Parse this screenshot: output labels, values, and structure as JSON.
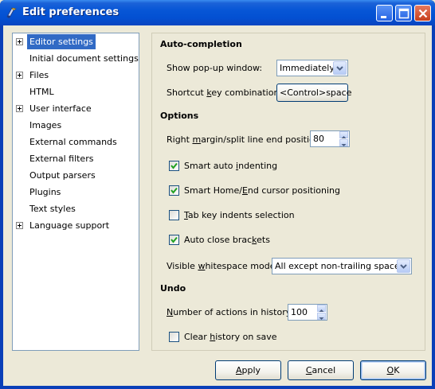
{
  "window": {
    "title": "Edit preferences",
    "icon": "gear-app-icon"
  },
  "tree": {
    "items": [
      {
        "label": "Editor settings",
        "expandable": true,
        "selected": true
      },
      {
        "label": "Initial document settings",
        "expandable": false
      },
      {
        "label": "Files",
        "expandable": true
      },
      {
        "label": "HTML",
        "expandable": false
      },
      {
        "label": "User interface",
        "expandable": true
      },
      {
        "label": "Images",
        "expandable": false
      },
      {
        "label": "External commands",
        "expandable": false
      },
      {
        "label": "External filters",
        "expandable": false
      },
      {
        "label": "Output parsers",
        "expandable": false
      },
      {
        "label": "Plugins",
        "expandable": false
      },
      {
        "label": "Text styles",
        "expandable": false
      },
      {
        "label": "Language support",
        "expandable": true
      }
    ]
  },
  "autocompletion": {
    "title": "Auto-completion",
    "popup_label": "Show pop-up window:",
    "popup_value": "Immediately",
    "shortcut_label_pre": "Shortcut ",
    "shortcut_label_key": "k",
    "shortcut_label_post": "ey combination:",
    "shortcut_value": "<Control>space"
  },
  "options": {
    "title": "Options",
    "right_margin_label_pre": "Right ",
    "right_margin_label_key": "m",
    "right_margin_label_post": "argin/split line end position:",
    "right_margin_value": "80",
    "smart_indent": {
      "pre": "Smart auto ",
      "key": "i",
      "post": "ndenting",
      "checked": true
    },
    "smart_home": {
      "pre": "Smart Home/",
      "key": "E",
      "post": "nd cursor positioning",
      "checked": true
    },
    "tab_indents": {
      "pre": "",
      "key": "T",
      "post": "ab key indents selection",
      "checked": false
    },
    "auto_close": {
      "pre": "Auto close brac",
      "key": "k",
      "post": "ets",
      "checked": true
    },
    "whitespace_label_pre": "Visible ",
    "whitespace_label_key": "w",
    "whitespace_label_post": "hitespace mode:",
    "whitespace_value": "All except non-trailing spaces"
  },
  "undo": {
    "title": "Undo",
    "actions_label_pre": "",
    "actions_label_key": "N",
    "actions_label_post": "umber of actions in history:",
    "actions_value": "100",
    "clear_history": {
      "pre": "Clear ",
      "key": "h",
      "post": "istory on save",
      "checked": false
    }
  },
  "buttons": {
    "apply": {
      "key": "A",
      "post": "pply"
    },
    "cancel": {
      "key": "C",
      "post": "ancel"
    },
    "ok": {
      "key": "O",
      "post": "K"
    }
  }
}
